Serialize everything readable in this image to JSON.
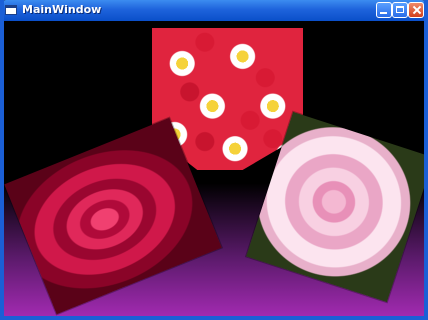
{
  "window": {
    "title": "MainWindow"
  },
  "photos": [
    {
      "subject": "daisies-and-red-flowers"
    },
    {
      "subject": "red-rose"
    },
    {
      "subject": "pink-rose"
    }
  ],
  "colors": {
    "titlebar": "#1e63dc",
    "background_bottom": "#a12ab0"
  }
}
